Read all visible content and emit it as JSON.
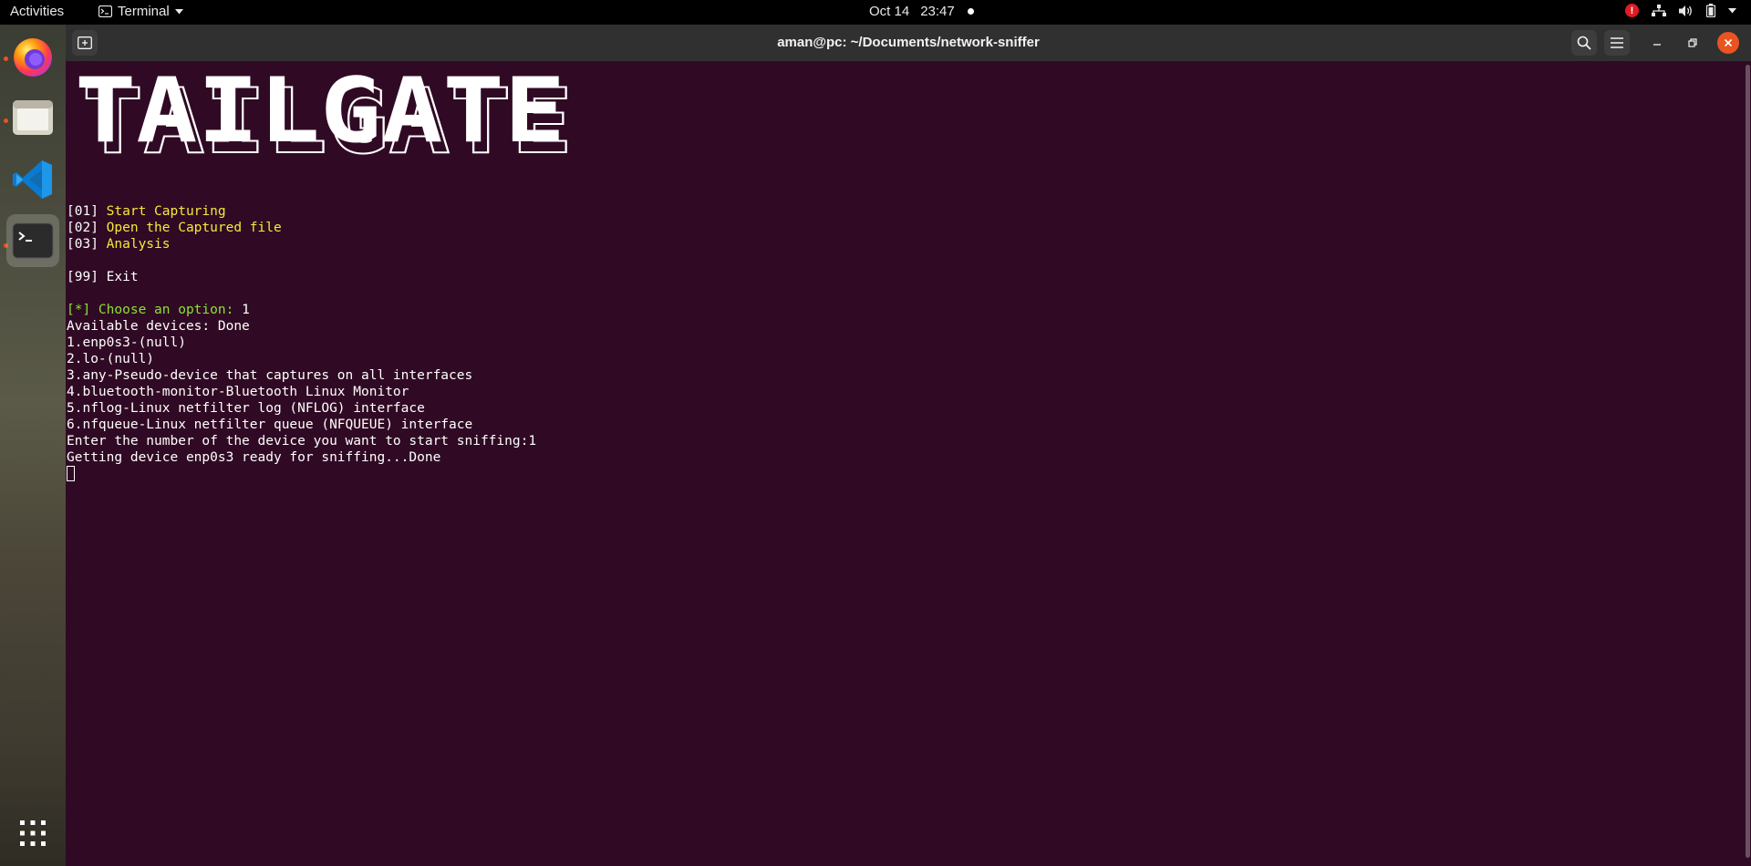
{
  "topbar": {
    "activities": "Activities",
    "app_name": "Terminal",
    "date": "Oct 14",
    "time": "23:47",
    "alert_badge": "!"
  },
  "dock": {
    "items": [
      "firefox-icon",
      "files-icon",
      "vscode-icon",
      "terminal-icon"
    ],
    "show_apps_icon": "grid-icon"
  },
  "window": {
    "title": "aman@pc: ~/Documents/network-sniffer"
  },
  "terminal": {
    "banner": "TAILGATE",
    "menu": [
      {
        "bracket": "[01]",
        "label": "Start Capturing"
      },
      {
        "bracket": "[02]",
        "label": "Open the Captured file"
      },
      {
        "bracket": "[03]",
        "label": "Analysis"
      }
    ],
    "exit": {
      "bracket": "[99]",
      "label": "Exit"
    },
    "prompt": {
      "label": "[*] Choose an option:",
      "value": "1"
    },
    "output": [
      "Available devices: Done",
      "1.enp0s3-(null)",
      "2.lo-(null)",
      "3.any-Pseudo-device that captures on all interfaces",
      "4.bluetooth-monitor-Bluetooth Linux Monitor",
      "5.nflog-Linux netfilter log (NFLOG) interface",
      "6.nfqueue-Linux netfilter queue (NFQUEUE) interface",
      "Enter the number of the device you want to start sniffing:1",
      "Getting device enp0s3 ready for sniffing...Done"
    ]
  },
  "colors": {
    "terminal_bg": "#300a24",
    "menu_yellow": "#f6e93a",
    "prompt_green": "#8ae234",
    "accent_orange": "#e95420"
  }
}
